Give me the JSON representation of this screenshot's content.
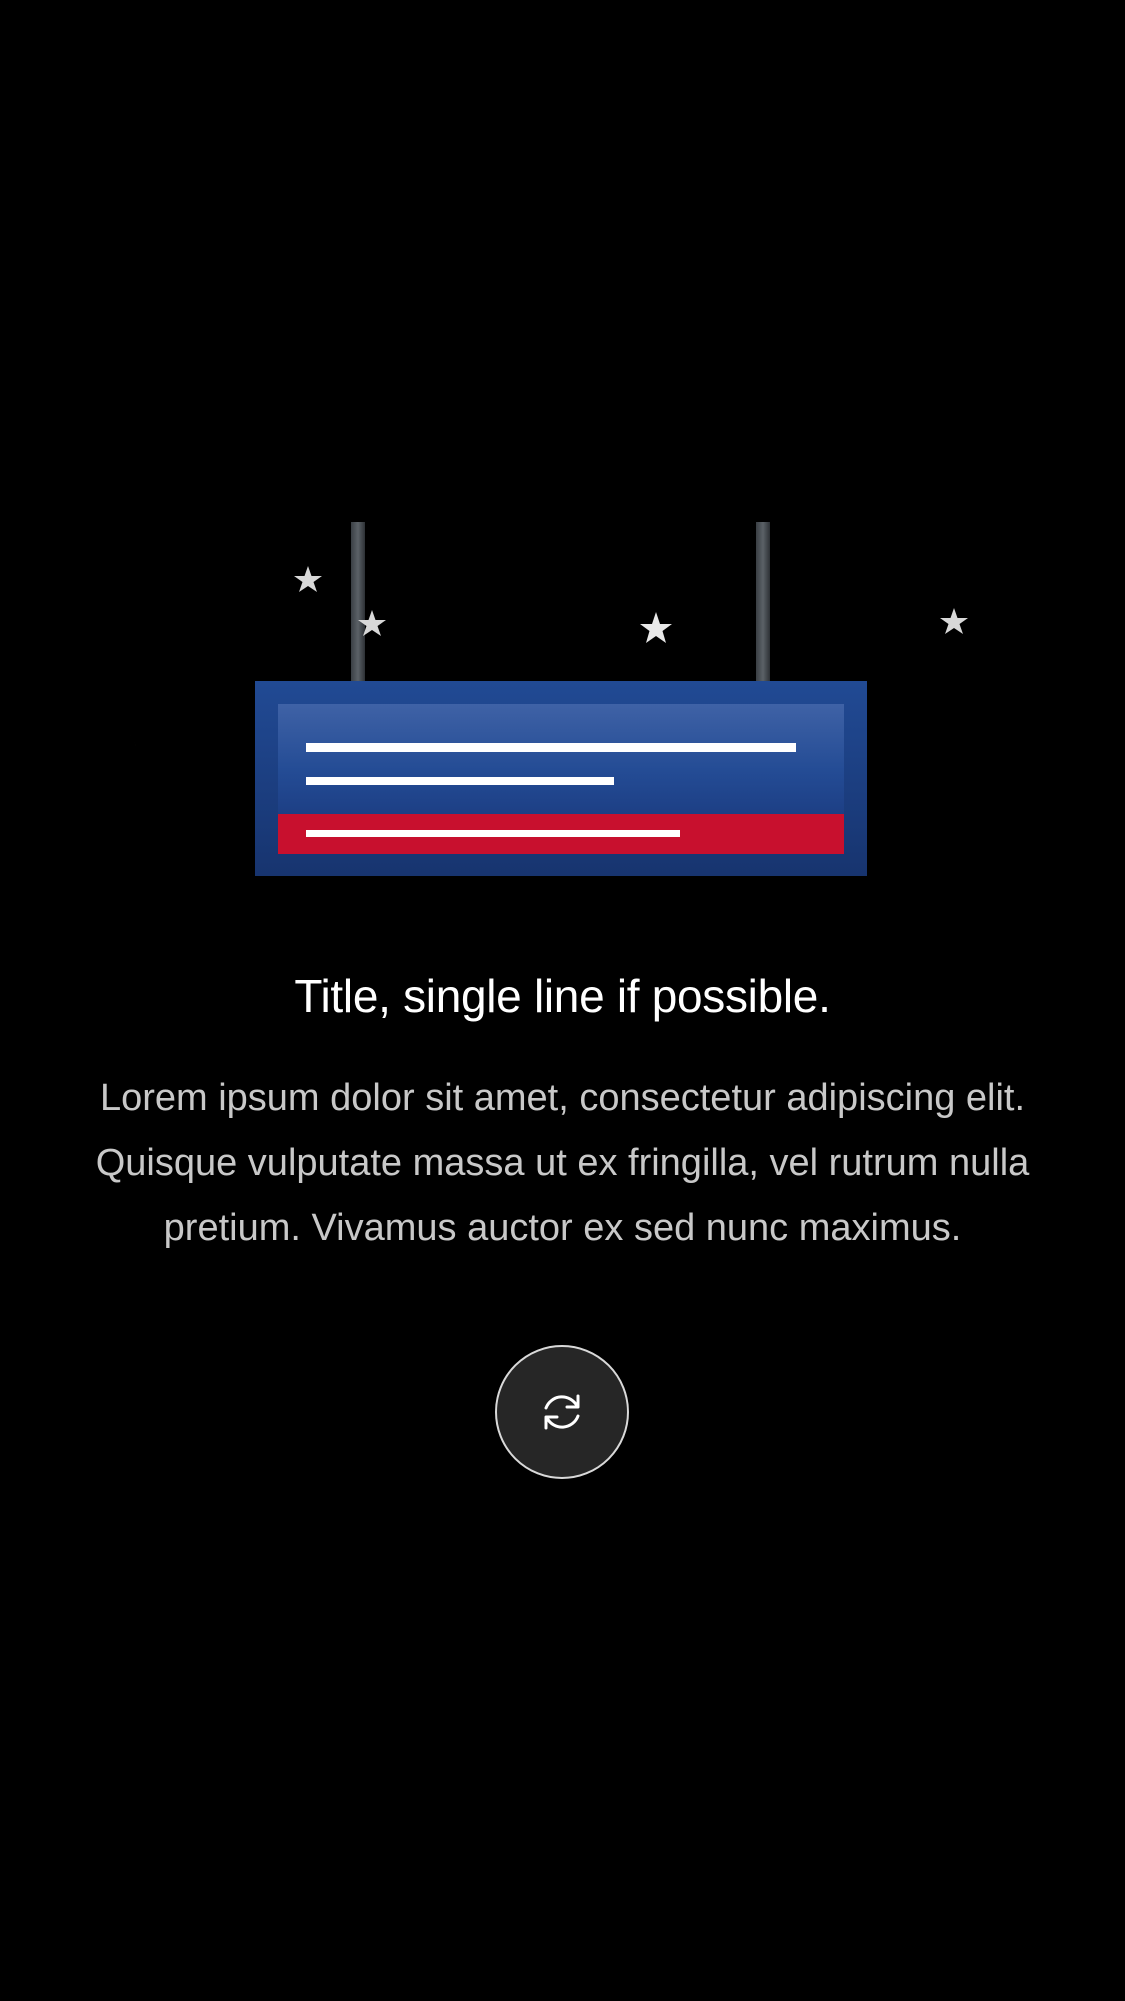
{
  "empty_state": {
    "title": "Title, single line if possible.",
    "description": "Lorem ipsum dolor sit amet, consectetur adipiscing elit. Quisque vulputate massa ut ex fringilla, vel rutrum nulla pretium. Vivamus auctor ex sed nunc maximus.",
    "refresh_button_icon": "refresh-icon"
  },
  "illustration": {
    "moon_icon": "crescent-moon",
    "star_count": 4,
    "sign_color": "#1b3f8a",
    "sign_accent_color": "#c8102e"
  },
  "colors": {
    "background": "#000000",
    "title": "#ffffff",
    "description": "#c8c8c8",
    "button_fill": "#262626",
    "button_border": "#d9d9d9"
  }
}
